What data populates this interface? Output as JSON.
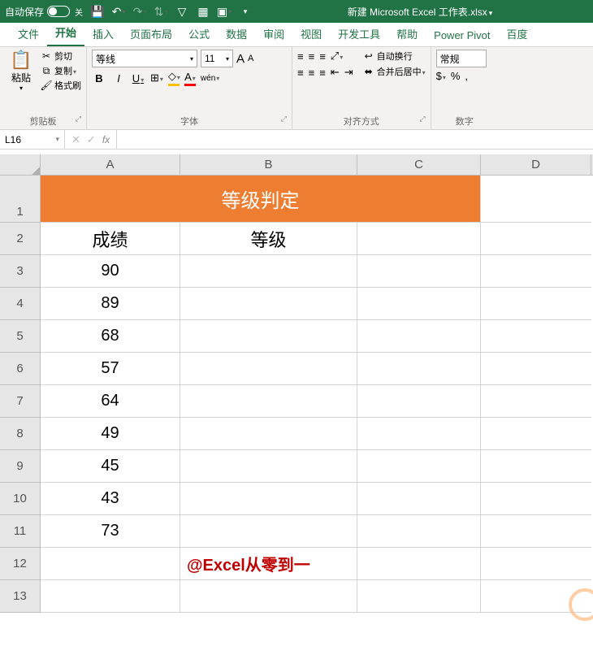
{
  "title_bar": {
    "autosave_label": "自动保存",
    "autosave_state": "关",
    "filename": "新建 Microsoft Excel 工作表.xlsx"
  },
  "tabs": {
    "file": "文件",
    "home": "开始",
    "insert": "插入",
    "layout": "页面布局",
    "formula": "公式",
    "data": "数据",
    "review": "审阅",
    "view": "视图",
    "dev": "开发工具",
    "help": "帮助",
    "power": "Power Pivot",
    "baidu": "百度"
  },
  "ribbon": {
    "clipboard": {
      "paste": "粘贴",
      "cut": "剪切",
      "copy": "复制",
      "format_painter": "格式刷",
      "group_label": "剪贴板"
    },
    "font": {
      "font_name": "等线",
      "font_size": "11",
      "increase": "A",
      "decrease": "A",
      "bold": "B",
      "italic": "I",
      "underline": "U",
      "phonetic": "wén",
      "group_label": "字体"
    },
    "align": {
      "wrap_text": "自动换行",
      "merge_center": "合并后居中",
      "group_label": "对齐方式"
    },
    "number": {
      "format": "常规",
      "group_label": "数字"
    }
  },
  "formula_bar": {
    "name_box": "L16",
    "fx": "fx"
  },
  "columns": [
    "A",
    "B",
    "C",
    "D"
  ],
  "sheet": {
    "merged_title": "等级判定",
    "header_a": "成绩",
    "header_b": "等级",
    "scores": [
      "90",
      "89",
      "68",
      "57",
      "64",
      "49",
      "45",
      "43",
      "73"
    ],
    "watermark": "@Excel从零到一"
  }
}
